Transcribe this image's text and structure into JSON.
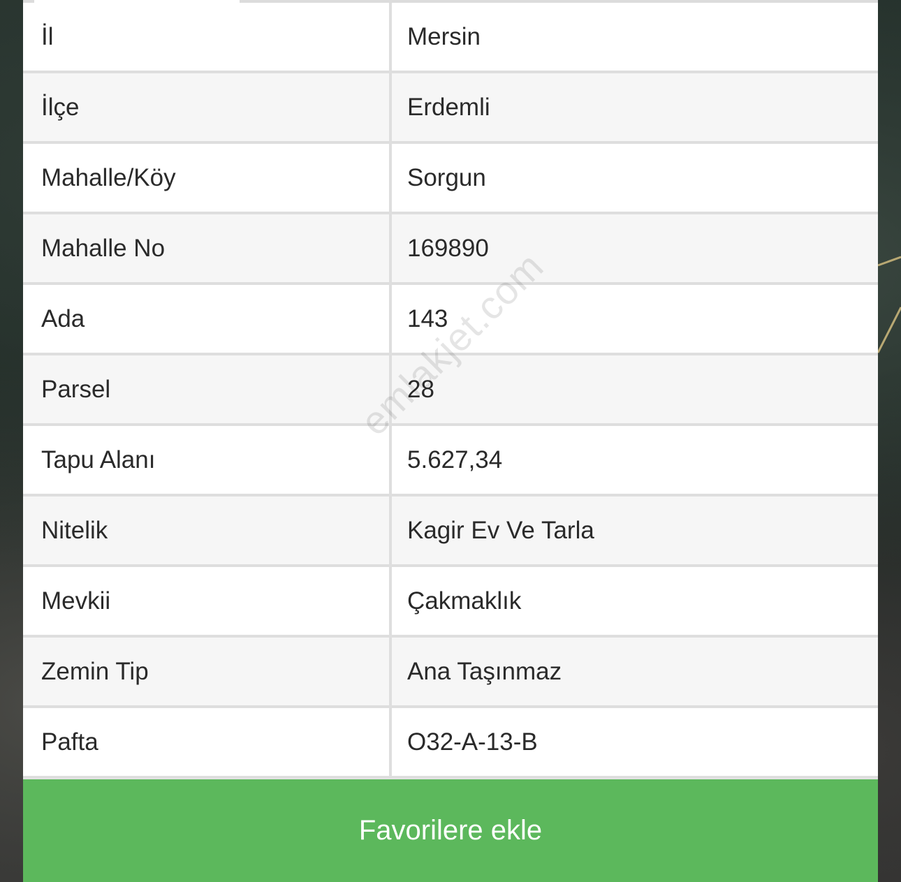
{
  "properties": [
    {
      "label": "İl",
      "value": "Mersin"
    },
    {
      "label": "İlçe",
      "value": "Erdemli"
    },
    {
      "label": "Mahalle/Köy",
      "value": "Sorgun"
    },
    {
      "label": "Mahalle No",
      "value": "169890"
    },
    {
      "label": "Ada",
      "value": "143"
    },
    {
      "label": "Parsel",
      "value": "28"
    },
    {
      "label": "Tapu Alanı",
      "value": "5.627,34"
    },
    {
      "label": "Nitelik",
      "value": "Kagir Ev Ve Tarla"
    },
    {
      "label": "Mevkii",
      "value": "Çakmaklık"
    },
    {
      "label": "Zemin Tip",
      "value": "Ana Taşınmaz"
    },
    {
      "label": "Pafta",
      "value": "O32-A-13-B"
    }
  ],
  "actions": {
    "favorite_label": "Favorilere ekle"
  },
  "watermark": "emlakjet.com",
  "colors": {
    "button_green": "#5cb85c",
    "row_light": "#ffffff",
    "row_alt": "#f6f6f6",
    "border": "#dedede",
    "map_boundary": "#b8a873"
  }
}
